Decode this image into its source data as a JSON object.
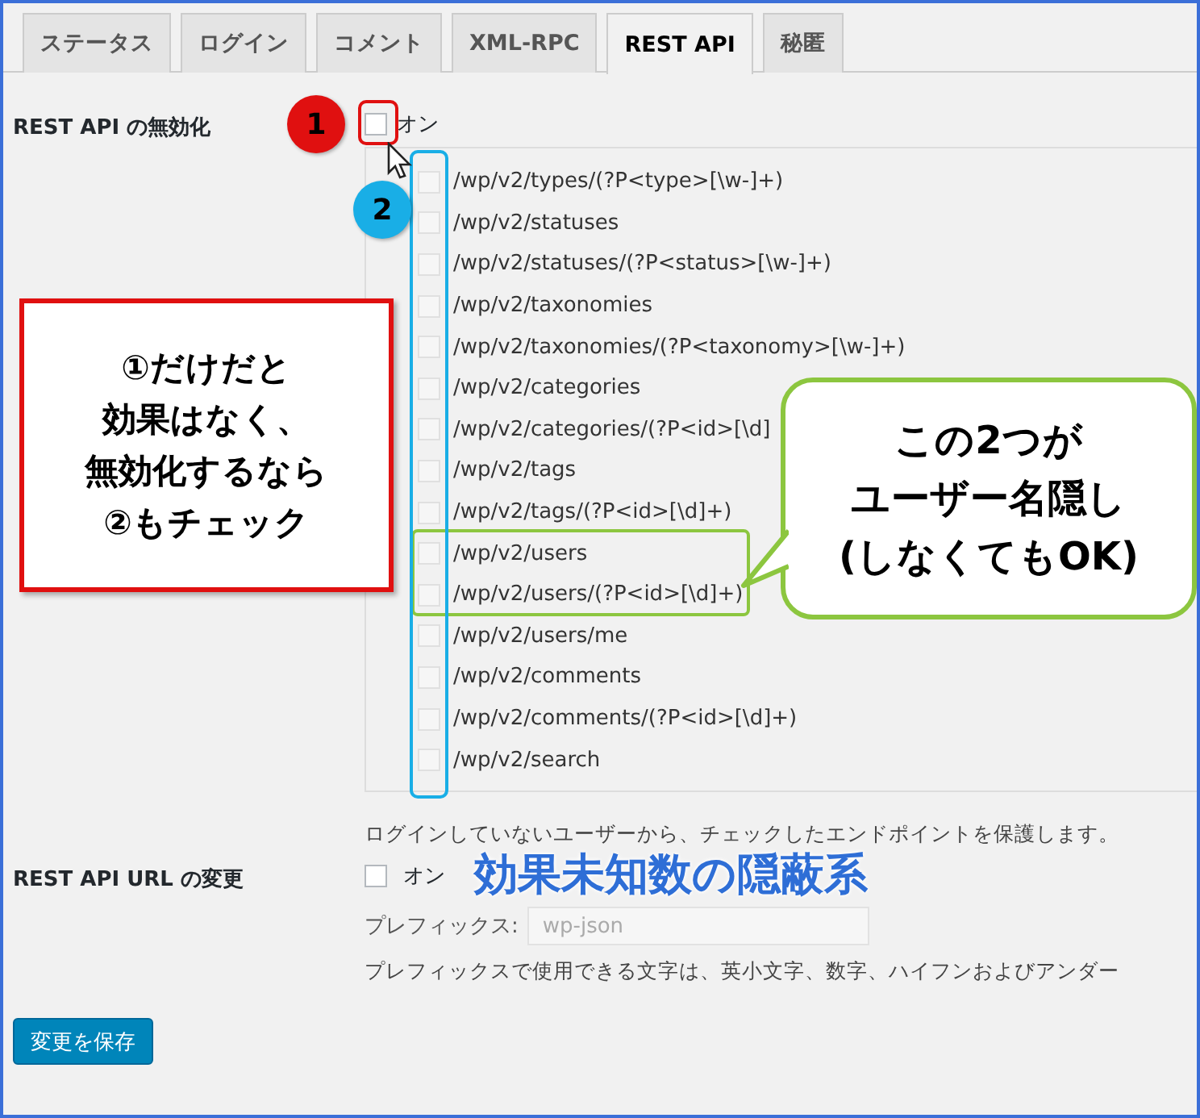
{
  "tabs": [
    {
      "label": "ステータス",
      "selected": false
    },
    {
      "label": "ログイン",
      "selected": false
    },
    {
      "label": "コメント",
      "selected": false
    },
    {
      "label": "XML-RPC",
      "selected": false
    },
    {
      "label": "REST API",
      "selected": true
    },
    {
      "label": "秘匿",
      "selected": false
    }
  ],
  "settings": [
    {
      "kind": "endpoints",
      "label": "REST API の無効化",
      "toggle": {
        "label": "オン",
        "checked": false
      },
      "endpoints": [
        {
          "path": "/wp/v2/types/(?P<type>[\\w-]+)",
          "checked": false,
          "highlighted": false
        },
        {
          "path": "/wp/v2/statuses",
          "checked": false,
          "highlighted": false
        },
        {
          "path": "/wp/v2/statuses/(?P<status>[\\w-]+)",
          "checked": false,
          "highlighted": false
        },
        {
          "path": "/wp/v2/taxonomies",
          "checked": false,
          "highlighted": false
        },
        {
          "path": "/wp/v2/taxonomies/(?P<taxonomy>[\\w-]+)",
          "checked": false,
          "highlighted": false
        },
        {
          "path": "/wp/v2/categories",
          "checked": false,
          "highlighted": false
        },
        {
          "path": "/wp/v2/categories/(?P<id>[\\d]",
          "checked": false,
          "highlighted": false
        },
        {
          "path": "/wp/v2/tags",
          "checked": false,
          "highlighted": false
        },
        {
          "path": "/wp/v2/tags/(?P<id>[\\d]+)",
          "checked": false,
          "highlighted": false
        },
        {
          "path": "/wp/v2/users",
          "checked": false,
          "highlighted": true
        },
        {
          "path": "/wp/v2/users/(?P<id>[\\d]+)",
          "checked": false,
          "highlighted": true
        },
        {
          "path": "/wp/v2/users/me",
          "checked": false,
          "highlighted": false
        },
        {
          "path": "/wp/v2/comments",
          "checked": false,
          "highlighted": false
        },
        {
          "path": "/wp/v2/comments/(?P<id>[\\d]+)",
          "checked": false,
          "highlighted": false
        },
        {
          "path": "/wp/v2/search",
          "checked": false,
          "highlighted": false
        }
      ],
      "description": "ログインしていないユーザーから、チェックしたエンドポイントを保護します。"
    },
    {
      "kind": "url",
      "label": "REST API URL の変更",
      "toggle": {
        "label": "オン",
        "checked": false
      },
      "prefix_label": "プレフィックス:",
      "prefix_placeholder": "wp-json",
      "description": "プレフィックスで使用できる文字は、英小文字、数字、ハイフンおよびアンダー"
    }
  ],
  "save_button": "変更を保存",
  "annotations": {
    "markers": [
      {
        "label": "1",
        "color": "#e01010"
      },
      {
        "label": "2",
        "color": "#19aee6"
      }
    ],
    "note_box": [
      "①だけだと",
      "効果はなく、",
      "無効化するなら",
      "②もチェック"
    ],
    "callout": [
      "この2つが",
      "ユーザー名隠し",
      "(しなくてもOK)"
    ],
    "caption": "効果未知数の隠蔽系"
  }
}
